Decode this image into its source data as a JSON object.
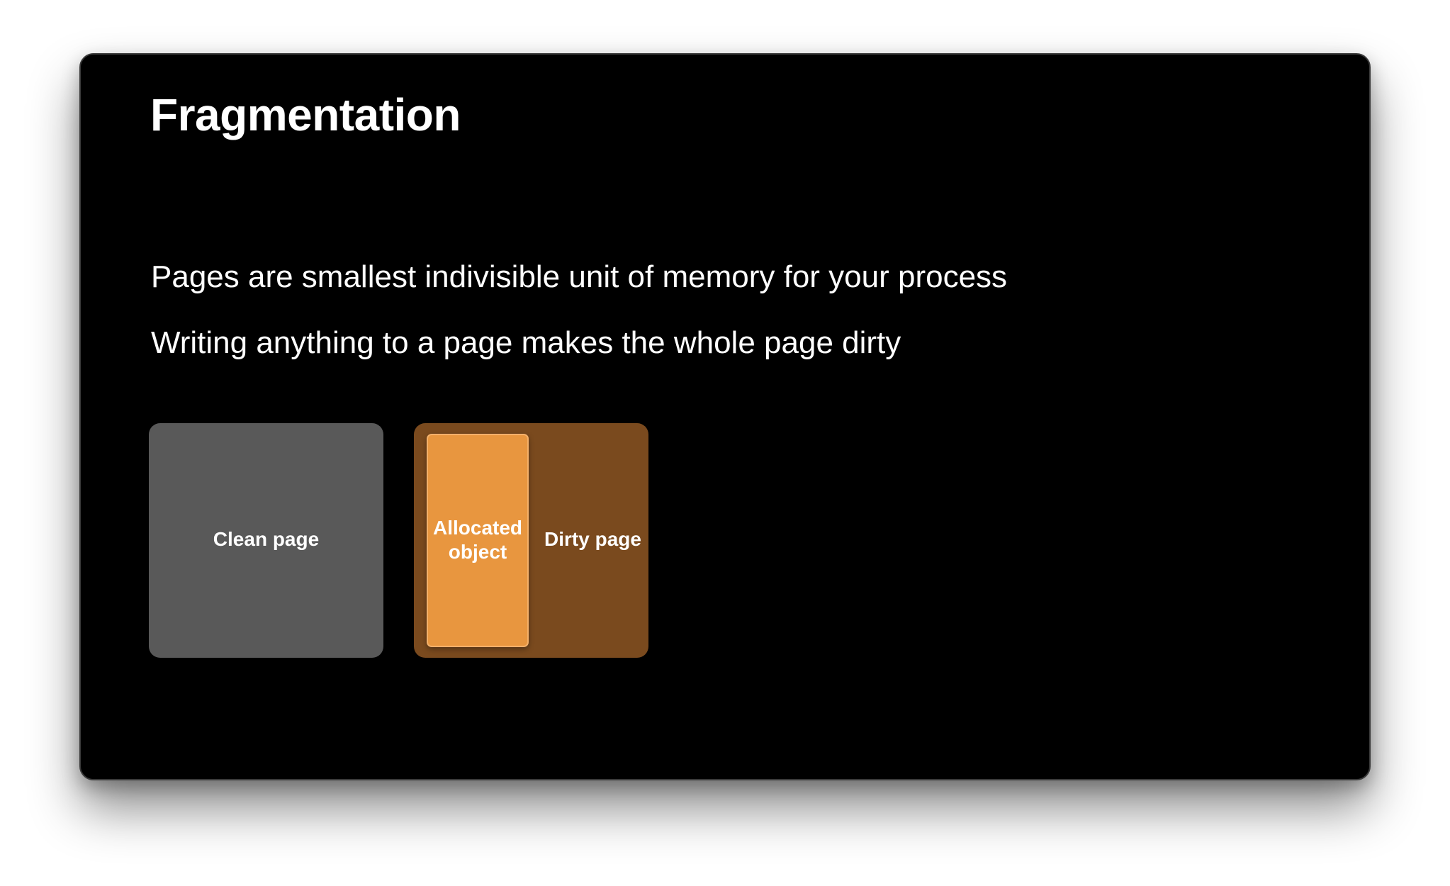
{
  "slide": {
    "title": "Fragmentation",
    "bullets": [
      "Pages are smallest indivisible unit of memory for your process",
      "Writing anything to a page makes the whole page dirty"
    ]
  },
  "diagram": {
    "clean_page": {
      "label": "Clean page",
      "color": "#595959"
    },
    "dirty_page": {
      "label": "Dirty page",
      "color": "#7a4a1e",
      "allocated_object": {
        "label": "Allocated object",
        "color": "#e8963f"
      }
    }
  },
  "colors": {
    "slide_background": "#000000",
    "text": "#ffffff"
  }
}
